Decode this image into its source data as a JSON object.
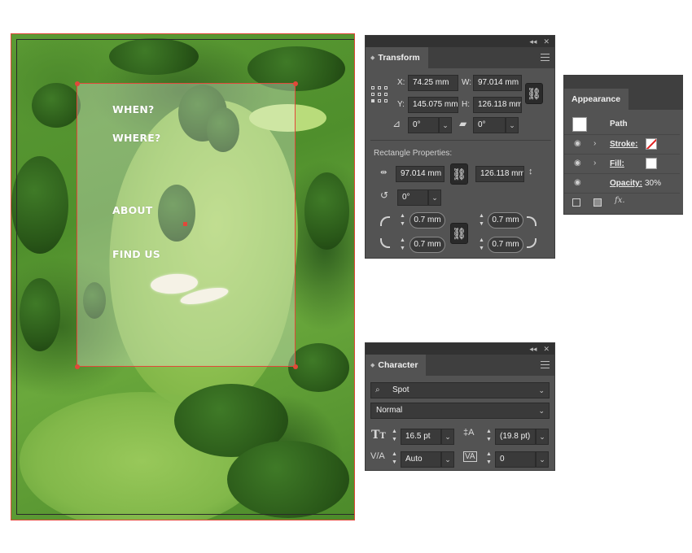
{
  "artboard": {
    "menu": [
      "WHEN?",
      "WHERE?",
      "ABOUT",
      "FIND US"
    ]
  },
  "transform": {
    "tab": "Transform",
    "x_label": "X:",
    "x": "74.25 mm",
    "y_label": "Y:",
    "y": "145.075 mm",
    "w_label": "W:",
    "w": "97.014 mm",
    "h_label": "H:",
    "h": "126.118 mm",
    "rotate": "0°",
    "shear": "0°",
    "rect_title": "Rectangle Properties:",
    "rect_w": "97.014 mm",
    "rect_h": "126.118 mm",
    "rect_rotate": "0°",
    "corner_tl": "0.7 mm",
    "corner_tr": "0.7 mm",
    "corner_bl": "0.7 mm",
    "corner_br": "0.7 mm"
  },
  "appearance": {
    "tab": "Appearance",
    "path_label": "Path",
    "stroke_label": "Stroke:",
    "fill_label": "Fill:",
    "opacity_label": "Opacity:",
    "opacity_value": "30%",
    "fx": "fx."
  },
  "character": {
    "tab": "Character",
    "font_family": "Spot",
    "font_style": "Normal",
    "font_size": "16.5 pt",
    "leading": "(19.8 pt)",
    "kerning": "Auto",
    "tracking": "0"
  },
  "colors": {
    "selection": "#e2483a",
    "panel_bg": "#535353",
    "panel_dark": "#323232"
  }
}
